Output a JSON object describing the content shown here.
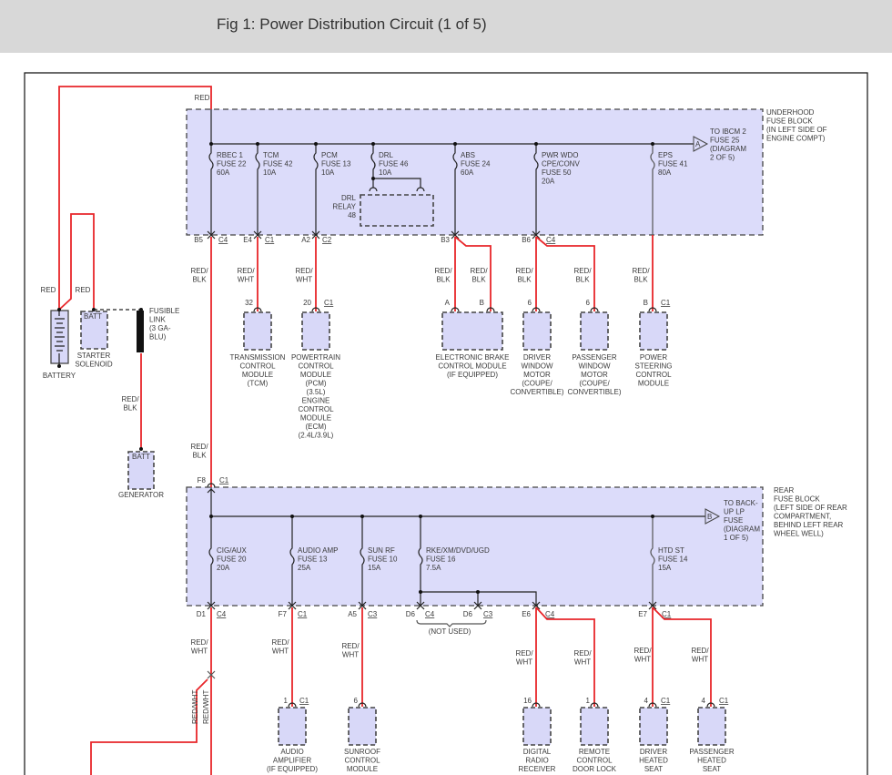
{
  "title": "Fig 1: Power Distribution Circuit (1 of 5)",
  "colors": {
    "wire_red": "#e8262a",
    "block_fill": "#dcdcfa",
    "header_bg": "#d8d8d8"
  },
  "underhood": {
    "label": [
      "UNDERHOOD",
      "FUSE BLOCK",
      "(IN LEFT SIDE OF",
      "ENGINE COMPT)"
    ],
    "offpage": {
      "letter": "A",
      "text": [
        "TO IBCM 2",
        "FUSE 25",
        "(DIAGRAM",
        "2 OF 5)"
      ]
    },
    "fuses": [
      {
        "lines": [
          "RBEC 1",
          "FUSE 22",
          "60A"
        ],
        "pin": "B5",
        "conn": "C4"
      },
      {
        "lines": [
          "TCM",
          "FUSE 42",
          "10A"
        ],
        "pin": "E4",
        "conn": "C1"
      },
      {
        "lines": [
          "PCM",
          "FUSE 13",
          "10A"
        ],
        "pin": "A2",
        "conn": "C2"
      },
      {
        "lines": [
          "DRL",
          "FUSE 46",
          "10A"
        ]
      },
      {
        "lines": [
          "ABS",
          "FUSE 24",
          "60A"
        ],
        "pin": "B3"
      },
      {
        "lines": [
          "PWR WDO",
          "CPE/CONV",
          "FUSE 50",
          "20A"
        ],
        "pin": "B6",
        "conn": "C4"
      },
      {
        "lines": [
          "EPS",
          "FUSE 41",
          "80A"
        ]
      }
    ],
    "relay": [
      "DRL",
      "RELAY",
      "48"
    ]
  },
  "power": {
    "wire_top": "RED",
    "wire_batt": "RED",
    "wire_solenoid": "RED",
    "battery": "BATTERY",
    "starter": {
      "pin": "BATT",
      "label": [
        "STARTER",
        "SOLENOID"
      ]
    },
    "fusible_link": [
      "FUSIBLE",
      "LINK",
      "(3 GA-",
      "BLU)"
    ],
    "gen_wire": [
      "RED/",
      "BLK"
    ],
    "generator": {
      "pin": "BATT",
      "label": "GENERATOR"
    },
    "trunk_wire_1": [
      "RED/",
      "BLK"
    ],
    "trunk_wire_2": [
      "RED/",
      "BLK"
    ]
  },
  "upper_modules": [
    {
      "wire": [
        "RED/",
        "WHT"
      ],
      "pin": "32",
      "label": [
        "TRANSMISSION",
        "CONTROL",
        "MODULE",
        "(TCM)"
      ]
    },
    {
      "wire": [
        "RED/",
        "WHT"
      ],
      "pin": "20",
      "conn": "C1",
      "label": [
        "POWERTRAIN",
        "CONTROL",
        "MODULE",
        "(PCM)",
        "(3.5L)",
        "ENGINE",
        "CONTROL",
        "MODULE",
        "(ECM)",
        "(2.4L/3.9L)"
      ]
    },
    {
      "wires": [
        [
          "RED/",
          "BLK"
        ],
        [
          "RED/",
          "BLK"
        ]
      ],
      "pins": [
        "A",
        "B"
      ],
      "label": [
        "ELECTRONIC BRAKE",
        "CONTROL MODULE",
        "(IF EQUIPPED)"
      ]
    },
    {
      "wire": [
        "RED/",
        "BLK"
      ],
      "pin": "6",
      "label": [
        "DRIVER",
        "WINDOW",
        "MOTOR",
        "(COUPE/",
        "CONVERTIBLE)"
      ]
    },
    {
      "wire": [
        "RED/",
        "BLK"
      ],
      "pin": "6",
      "label": [
        "PASSENGER",
        "WINDOW",
        "MOTOR",
        "(COUPE/",
        "CONVERTIBLE)"
      ]
    },
    {
      "wire": [
        "RED/",
        "BLK"
      ],
      "pin": "B",
      "conn": "C1",
      "label": [
        "POWER",
        "STEERING",
        "CONTROL",
        "MODULE"
      ]
    }
  ],
  "rear": {
    "in_pin": "F8",
    "in_conn": "C1",
    "label": [
      "REAR",
      "FUSE BLOCK",
      "(LEFT SIDE OF REAR",
      "COMPARTMENT,",
      "BEHIND LEFT REAR",
      "WHEEL WELL)"
    ],
    "offpage": {
      "letter": "B",
      "text": [
        "TO BACK-",
        "UP LP",
        "FUSE",
        "(DIAGRAM",
        "1 OF 5)"
      ]
    },
    "fuses": [
      {
        "lines": [
          "CIG/AUX",
          "FUSE 20",
          "20A"
        ],
        "pin": "D1",
        "conn": "C4"
      },
      {
        "lines": [
          "AUDIO AMP",
          "FUSE 13",
          "25A"
        ],
        "pin": "F7",
        "conn": "C1"
      },
      {
        "lines": [
          "SUN RF",
          "FUSE 10",
          "15A"
        ],
        "pin": "A5",
        "conn": "C3"
      },
      {
        "lines": [
          "RKE/XM/DVD/UGD",
          "FUSE 16",
          "7.5A"
        ],
        "pin": "D6",
        "conn": "C4",
        "pin2": "D6",
        "conn2": "C3",
        "pin3": "E6",
        "conn3": "C4",
        "note": "(NOT USED)"
      },
      {
        "lines": [
          "HTD ST",
          "FUSE 14",
          "15A"
        ],
        "pin": "E7",
        "conn": "C1"
      }
    ]
  },
  "lower": {
    "cig_wire": [
      "RED/",
      "WHT"
    ],
    "vert_wire_1": "RED/WHT",
    "vert_wire_2": "RED/WHT",
    "modules": [
      {
        "wire": [
          "RED/",
          "WHT"
        ],
        "pin": "1",
        "conn": "C1",
        "label": [
          "AUDIO",
          "AMPLIFIER",
          "(IF EQUIPPED)"
        ]
      },
      {
        "wire": [
          "RED/",
          "WHT"
        ],
        "pin": "6",
        "label": [
          "SUNROOF",
          "CONTROL",
          "MODULE"
        ]
      },
      {
        "wire": [
          "RED/",
          "WHT"
        ],
        "pin": "16",
        "label": [
          "DIGITAL",
          "RADIO",
          "RECEIVER"
        ]
      },
      {
        "wire": [
          "RED/",
          "WHT"
        ],
        "pin": "1",
        "label": [
          "REMOTE",
          "CONTROL",
          "DOOR LOCK"
        ]
      },
      {
        "wire": [
          "RED/",
          "WHT"
        ],
        "pin": "4",
        "conn": "C1",
        "label": [
          "DRIVER",
          "HEATED",
          "SEAT"
        ]
      },
      {
        "wire": [
          "RED/",
          "WHT"
        ],
        "pin": "4",
        "conn": "C1",
        "label": [
          "PASSENGER",
          "HEATED",
          "SEAT"
        ]
      }
    ]
  }
}
